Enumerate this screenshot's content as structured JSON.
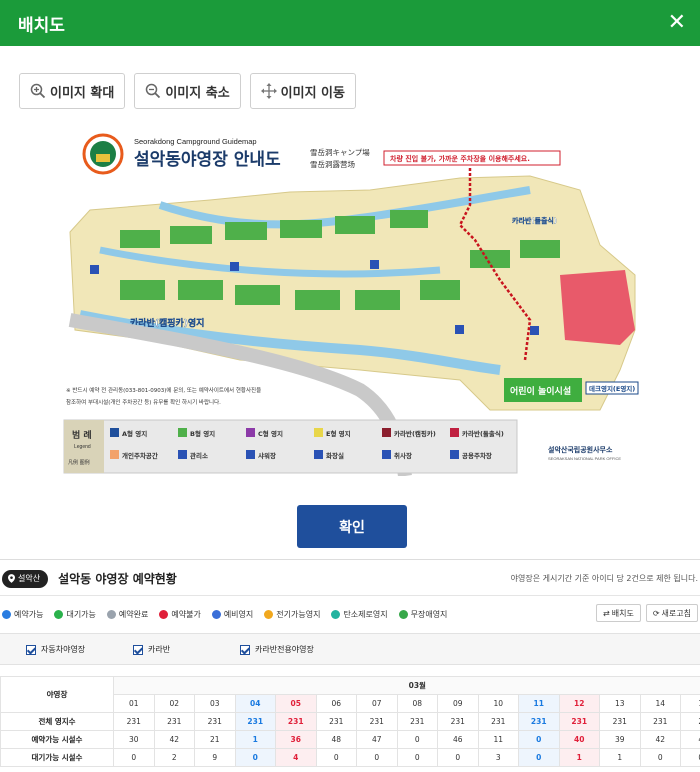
{
  "modal": {
    "title": "배치도",
    "close_icon": "close-icon"
  },
  "toolbar": {
    "zoom_in_label": "이미지 확대",
    "zoom_out_label": "이미지 축소",
    "move_label": "이미지 이동"
  },
  "map": {
    "guide_en": "Seorakdong Campground Guidemap",
    "title": "설악동야영장 안내도",
    "title_jp": "雪岳洞キャンプ場",
    "title_cn": "雪岳洞露营场",
    "notice": "차량 진입 불가, 가까운 주차장을 이용해주세요.",
    "zone_caravan_tent": "카라반(캠핑카)영지",
    "zone_caravan_rooftop": "카라반(돌출식)",
    "playground": "어린이 놀이시설",
    "deck_zone": "데크영지(E영지)",
    "footnote_1": "※ 반드시 예약 전 관리동(033-801-0903)에 문의, 또는 예약사이트에서 현황사진을",
    "footnote_2": "참조하여 부대시설(개인 주차공간 등) 유무를 확인 하시기 바랍니다.",
    "legend_title": "범 례",
    "legend_sub": "Legend",
    "legend_fan": "凡例 图例",
    "legend_items": [
      "A형 영지",
      "B형 영지",
      "C형 영지",
      "E형 영지",
      "카라반(캠핑카)",
      "카라반(돌출식)",
      "개인주차공간",
      "관리소",
      "샤워장",
      "화장실",
      "취사장",
      "공용주차장"
    ],
    "park_office": "설악산국립공원사무소",
    "park_office_en": "SEORAKSAN NATIONAL PARK OFFICE"
  },
  "confirm_label": "확인",
  "reservation": {
    "location_badge": "설악산",
    "title": "설악동 야영장 예약현황",
    "notice": "야영장은 게시기간 기준 아이디 당 2건으로 제한 됩니다.",
    "layout_button": "배치도",
    "refresh_button": "새로고침",
    "legend": [
      {
        "label": "예약가능",
        "color": "#2a7de1"
      },
      {
        "label": "대기가능",
        "color": "#2bb24c"
      },
      {
        "label": "예약완료",
        "color": "#9aa3ad"
      },
      {
        "label": "예약불가",
        "color": "#e0203a"
      },
      {
        "label": "예비영지",
        "color": "#3a6fd8"
      },
      {
        "label": "전기가능영지",
        "color": "#f1a81e"
      },
      {
        "label": "탄소제로영지",
        "color": "#23b3a0"
      },
      {
        "label": "무장애영지",
        "color": "#37a84a"
      }
    ],
    "filters": [
      "자동차야영장",
      "카라반",
      "카라반전용야영장"
    ],
    "table": {
      "corner": "야영장",
      "month": "03월",
      "days": [
        "01",
        "02",
        "03",
        "04",
        "05",
        "06",
        "07",
        "08",
        "09",
        "10",
        "11",
        "12",
        "13",
        "14",
        "1"
      ],
      "day_types": [
        "",
        "",
        "",
        "sat",
        "sun",
        "",
        "",
        "",
        "",
        "",
        "sat",
        "sun",
        "",
        "",
        ""
      ],
      "rows": [
        {
          "label": "전체 영지수",
          "values": [
            "231",
            "231",
            "231",
            "231",
            "231",
            "231",
            "231",
            "231",
            "231",
            "231",
            "231",
            "231",
            "231",
            "231",
            "2"
          ]
        },
        {
          "label": "예약가능 시설수",
          "values": [
            "30",
            "42",
            "21",
            "1",
            "36",
            "48",
            "47",
            "0",
            "46",
            "11",
            "0",
            "40",
            "39",
            "42",
            "4"
          ]
        },
        {
          "label": "대기가능 시설수",
          "values": [
            "0",
            "2",
            "9",
            "0",
            "4",
            "0",
            "0",
            "0",
            "0",
            "3",
            "0",
            "1",
            "1",
            "0",
            "0"
          ]
        }
      ]
    }
  }
}
